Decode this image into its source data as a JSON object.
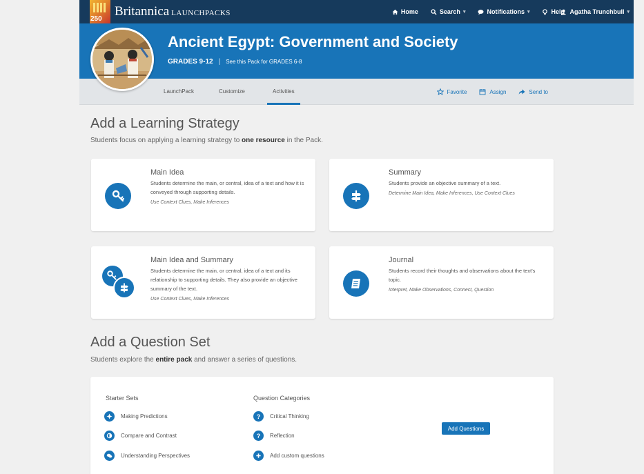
{
  "brand": {
    "badge_number": "250",
    "name": "Britannica",
    "product": "LAUNCHPACKS"
  },
  "topnav": {
    "home": "Home",
    "search": "Search",
    "notifications": "Notifications",
    "help": "Help",
    "user": "Agatha Trunchbull"
  },
  "hero": {
    "title": "Ancient Egypt: Government and Society",
    "grade": "GRADES 9-12",
    "separator": "|",
    "alt_link": "See this Pack for GRADES 6-8"
  },
  "tabs": [
    "LaunchPack",
    "Customize",
    "Activities"
  ],
  "active_tab": "Activities",
  "actions": {
    "favorite": "Favorite",
    "assign": "Assign",
    "send_to": "Send to"
  },
  "strategy": {
    "heading": "Add a Learning Strategy",
    "desc_pre": "Students focus on applying a learning strategy to ",
    "desc_bold": "one resource",
    "desc_post": " in the Pack.",
    "cards": [
      {
        "title": "Main Idea",
        "desc": "Students determine the main, or central, idea of a text and how it is conveyed through supporting details.",
        "skills": "Use Context Clues, Make Inferences",
        "icon": "key-icon"
      },
      {
        "title": "Summary",
        "desc": "Students provide an objective summary of a text.",
        "skills": "Determine Main Idea, Make Inferences, Use Context Clues",
        "icon": "signpost-icon"
      },
      {
        "title": "Main Idea and Summary",
        "desc": "Students determine the main, or central, idea of a text and its relationship to supporting details. They also provide an objective summary of the text.",
        "skills": "Use Context Clues, Make Inferences",
        "icon": "key-signpost-icon"
      },
      {
        "title": "Journal",
        "desc": "Students record their thoughts and observations about the text's topic.",
        "skills": "Interpret, Make Observations, Connect, Question",
        "icon": "journal-icon"
      }
    ]
  },
  "questions": {
    "heading": "Add a Question Set",
    "desc_pre": "Students explore the ",
    "desc_bold": "entire pack",
    "desc_post": " and answer a series of questions.",
    "starter_heading": "Starter Sets",
    "starter_sets": [
      "Making Predictions",
      "Compare and Contrast",
      "Understanding Perspectives"
    ],
    "category_heading": "Question Categories",
    "categories": [
      "Critical Thinking",
      "Reflection",
      "Add custom questions"
    ],
    "add_button": "Add Questions"
  },
  "colors": {
    "navy": "#163a5c",
    "brand_blue": "#1874b8",
    "page_bg": "#f0f0f0"
  }
}
